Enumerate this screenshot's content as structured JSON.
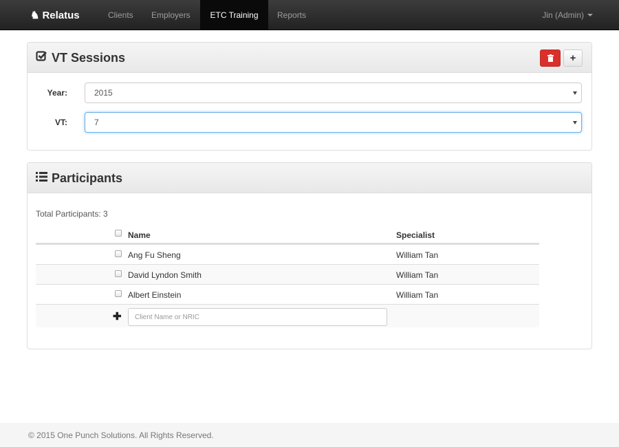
{
  "navbar": {
    "brand": "Relatus",
    "brand_icon": "puzzle-icon",
    "items": [
      {
        "label": "Clients",
        "active": false
      },
      {
        "label": "Employers",
        "active": false
      },
      {
        "label": "ETC Training",
        "active": true
      },
      {
        "label": "Reports",
        "active": false
      }
    ],
    "user": "Jin (Admin)"
  },
  "sessions": {
    "title": "VT Sessions",
    "title_icon": "check-square-icon",
    "delete_icon": "trash-icon",
    "add_label": "+",
    "year_label": "Year:",
    "year_value": "2015",
    "vt_label": "VT:",
    "vt_value": "7"
  },
  "participants": {
    "title": "Participants",
    "title_icon": "list-icon",
    "total": "Total Participants: 3",
    "columns": {
      "name": "Name",
      "specialist": "Specialist"
    },
    "rows": [
      {
        "name": "Ang Fu Sheng",
        "specialist": "William Tan"
      },
      {
        "name": "David Lyndon Smith",
        "specialist": "William Tan"
      },
      {
        "name": "Albert Einstein",
        "specialist": "William Tan"
      }
    ],
    "add_icon": "plus-icon",
    "input_placeholder": "Client Name or NRIC"
  },
  "footer": {
    "text": "© 2015 One Punch Solutions. All Rights Reserved."
  },
  "colors": {
    "navbar_bg": "#222222",
    "delete_button": "#d9302c",
    "focus_border": "#66afe9"
  }
}
